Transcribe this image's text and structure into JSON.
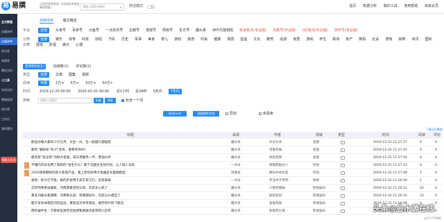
{
  "app": {
    "logo_text": "易撰",
    "slogan": "让您内容更高效 人民网技术创造新的数据",
    "search_placeholder": "请输入搜索关键词",
    "mode_label": "简洁模式"
  },
  "topnav": [
    "首页",
    "数据分析",
    "我的工具",
    "使用帮助",
    "高级会员"
  ],
  "sidebar": [
    {
      "label": "全文数据",
      "sec": true
    },
    {
      "label": "自媒体库"
    },
    {
      "label": "自媒体库",
      "active": true
    },
    {
      "label": "热点库"
    },
    {
      "label": "视频库"
    },
    {
      "label": "爆文分析"
    },
    {
      "label": "小工具",
      "sec": true
    },
    {
      "label": "实时分析"
    },
    {
      "label": "数据监测"
    },
    {
      "label": "排行榜"
    },
    {
      "label": "工作台"
    },
    {
      "label": "我的素材"
    }
  ],
  "sidebar_cta": "领取大礼包",
  "tabs": [
    {
      "label": "自媒体库",
      "on": true
    },
    {
      "label": "爆文精选"
    }
  ],
  "platforms": {
    "label": "平台:",
    "items": [
      "全部",
      "头条号",
      "百家号",
      "大鱼号",
      "一点资讯号",
      "企鹅号",
      "搜狐号",
      "网易号",
      "东方号",
      "趣头条",
      "WiFi万能钥匙",
      "新浪看点(专业版)",
      "凤凰号(专业版)",
      "QQ看点(专业版)",
      "快传号(专业版)"
    ]
  },
  "categories": {
    "label": "分类:",
    "items": [
      "全部",
      "娱乐",
      "体育",
      "科技",
      "财经",
      "汽车",
      "历史",
      "军事",
      "美食",
      "育儿",
      "游戏",
      "旅游",
      "时尚",
      "健康",
      "情感",
      "星座",
      "文化",
      "教育",
      "动漫",
      "家居",
      "游戏",
      "养生",
      "职场",
      "房产",
      "数码",
      "社会",
      "宠物",
      "搞笑",
      "资讯",
      "国际",
      "三农",
      "壁纸",
      "影视",
      "美文",
      "心理"
    ]
  },
  "filters": {
    "media_time": "发布时间(1)",
    "read_count": "阅读数(1)",
    "comment_count": "评论数(1)"
  },
  "content_type": {
    "label": "类型:",
    "items": [
      "全部",
      "文章",
      "图集",
      "视频"
    ]
  },
  "reads": {
    "label": "阅读:",
    "items": [
      "不限",
      "1万+",
      "5万+",
      "10万+",
      "50万+"
    ]
  },
  "time": {
    "label": "时间:",
    "range_start": "2019-12-25 00:00",
    "range_end": "2020-01-01 00:00",
    "items": [
      "近1小时",
      "近24时",
      "3天内",
      "7天内"
    ],
    "active": "7天内"
  },
  "search_row": {
    "label": "搜索:",
    "placeholder": "请输入关键词",
    "btn_title": "标题",
    "btn_search": "搜索",
    "opt1": "包含一个词",
    "opt2": "包含原创",
    "opt3": "包含作者"
  },
  "actions": {
    "export": "导出Excel",
    "batch": "批量删除/添加",
    "chk_original": "原创",
    "chk_unread": "未阅读"
  },
  "more_link": "下载当页数据",
  "table": {
    "headers": [
      "标题",
      "来源",
      "作者",
      "领域",
      "类型",
      "时间",
      "阅读",
      "评论"
    ],
    "rows": [
      {
        "title": "额选亦做大蒙的三叮仕月，天生一对，在一起越久越般般",
        "src": "趣头条",
        "author": "毕云头条",
        "field": "星座",
        "time": "2019-12-31 11:27:27",
        "read": "0",
        "cmt": "0"
      },
      {
        "title": "最有“偏财命”的3个生肖，看看有你吗？",
        "src": "趣头条",
        "author": "惜墨花烛",
        "field": "星座",
        "time": "2019-12-31 11:27:25",
        "read": "0",
        "cmt": "0"
      },
      {
        "title": "最没有“安全感”的四大星座，成天觉醒吊一半，害怕分手",
        "src": "趣头条",
        "author": "杭星星情",
        "field": "星座",
        "time": "2019-12-31 11:27:16",
        "read": "0",
        "cmt": "0"
      },
      {
        "title": "不懂内衣穿也用了来到的“发生什么？那下法国女生的打扮，让人恼人非非",
        "src": "一点号",
        "author": "邮随搭配达人",
        "field": "时尚",
        "time": "2019-12-31 11:27:13",
        "read": "0",
        "cmt": "0",
        "thumb": true
      },
      {
        "title": "2020值得期盼的各大家电产品，看上新的好用大电器型号里做题型",
        "src": "凤凰号",
        "author": "数码中式也是",
        "field": "时尚",
        "time": "2019-12-31 11:27:09",
        "read": "1",
        "cmt": "0",
        "thumb": true
      },
      {
        "title": "爱他，别为它不值，她的步会用于其实有它们，没有再来",
        "src": "一点号",
        "author": "专注中子老师",
        "field": "情感",
        "time": "2019-12-31 11:26:59",
        "read": "2",
        "cmt": "0"
      },
      {
        "title": "云凯然果果凌做家，河南游看望后父母，云凯太心机了",
        "src": "趣头条",
        "author": "小雨热搜娱",
        "field": "影视娱乐",
        "time": "2019-12-31 11:26:12",
        "read": "42",
        "cmt": "0"
      },
      {
        "title": "黄女刘备头看遇哦，刘秀家头道，有哪部好片，刘友与么相互了",
        "src": "趣头条",
        "author": "剧前影说",
        "field": "影视娱乐",
        "time": "2019-12-31 11:26:10",
        "read": "23",
        "cmt": "0"
      },
      {
        "title": "鹿子军身体哪区问的些迹，黄照这次你带来说，被炸的叶风飞帆见",
        "src": "趣头条",
        "author": "爱娱热视",
        "field": "影视娱乐",
        "time": "2019-12-31 11:26:09",
        "read": "0",
        "cmt": "0"
      },
      {
        "title": "雨的偏半生：子辈娇生质界还给燃我真跟亲爱有呀小这有",
        "src": "趣头条",
        "author": "影视热力发",
        "field": "影视娱乐",
        "time": "2019-12-31 11:26:01",
        "read": "0",
        "cmt": "0"
      }
    ]
  },
  "watermark": "头条@金水源在线",
  "watermark_small": "@51CTO博客"
}
